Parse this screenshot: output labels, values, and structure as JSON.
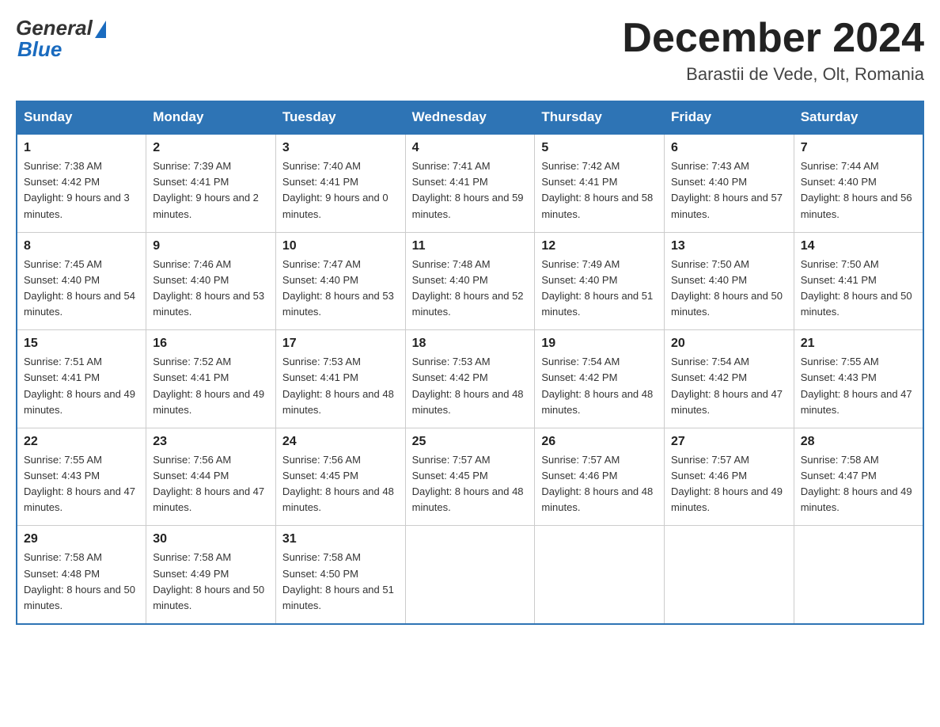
{
  "header": {
    "logo": {
      "general": "General",
      "blue": "Blue"
    },
    "title": "December 2024",
    "location": "Barastii de Vede, Olt, Romania"
  },
  "calendar": {
    "weekdays": [
      "Sunday",
      "Monday",
      "Tuesday",
      "Wednesday",
      "Thursday",
      "Friday",
      "Saturday"
    ],
    "weeks": [
      [
        {
          "day": 1,
          "sunrise": "7:38 AM",
          "sunset": "4:42 PM",
          "daylight": "9 hours and 3 minutes."
        },
        {
          "day": 2,
          "sunrise": "7:39 AM",
          "sunset": "4:41 PM",
          "daylight": "9 hours and 2 minutes."
        },
        {
          "day": 3,
          "sunrise": "7:40 AM",
          "sunset": "4:41 PM",
          "daylight": "9 hours and 0 minutes."
        },
        {
          "day": 4,
          "sunrise": "7:41 AM",
          "sunset": "4:41 PM",
          "daylight": "8 hours and 59 minutes."
        },
        {
          "day": 5,
          "sunrise": "7:42 AM",
          "sunset": "4:41 PM",
          "daylight": "8 hours and 58 minutes."
        },
        {
          "day": 6,
          "sunrise": "7:43 AM",
          "sunset": "4:40 PM",
          "daylight": "8 hours and 57 minutes."
        },
        {
          "day": 7,
          "sunrise": "7:44 AM",
          "sunset": "4:40 PM",
          "daylight": "8 hours and 56 minutes."
        }
      ],
      [
        {
          "day": 8,
          "sunrise": "7:45 AM",
          "sunset": "4:40 PM",
          "daylight": "8 hours and 54 minutes."
        },
        {
          "day": 9,
          "sunrise": "7:46 AM",
          "sunset": "4:40 PM",
          "daylight": "8 hours and 53 minutes."
        },
        {
          "day": 10,
          "sunrise": "7:47 AM",
          "sunset": "4:40 PM",
          "daylight": "8 hours and 53 minutes."
        },
        {
          "day": 11,
          "sunrise": "7:48 AM",
          "sunset": "4:40 PM",
          "daylight": "8 hours and 52 minutes."
        },
        {
          "day": 12,
          "sunrise": "7:49 AM",
          "sunset": "4:40 PM",
          "daylight": "8 hours and 51 minutes."
        },
        {
          "day": 13,
          "sunrise": "7:50 AM",
          "sunset": "4:40 PM",
          "daylight": "8 hours and 50 minutes."
        },
        {
          "day": 14,
          "sunrise": "7:50 AM",
          "sunset": "4:41 PM",
          "daylight": "8 hours and 50 minutes."
        }
      ],
      [
        {
          "day": 15,
          "sunrise": "7:51 AM",
          "sunset": "4:41 PM",
          "daylight": "8 hours and 49 minutes."
        },
        {
          "day": 16,
          "sunrise": "7:52 AM",
          "sunset": "4:41 PM",
          "daylight": "8 hours and 49 minutes."
        },
        {
          "day": 17,
          "sunrise": "7:53 AM",
          "sunset": "4:41 PM",
          "daylight": "8 hours and 48 minutes."
        },
        {
          "day": 18,
          "sunrise": "7:53 AM",
          "sunset": "4:42 PM",
          "daylight": "8 hours and 48 minutes."
        },
        {
          "day": 19,
          "sunrise": "7:54 AM",
          "sunset": "4:42 PM",
          "daylight": "8 hours and 48 minutes."
        },
        {
          "day": 20,
          "sunrise": "7:54 AM",
          "sunset": "4:42 PM",
          "daylight": "8 hours and 47 minutes."
        },
        {
          "day": 21,
          "sunrise": "7:55 AM",
          "sunset": "4:43 PM",
          "daylight": "8 hours and 47 minutes."
        }
      ],
      [
        {
          "day": 22,
          "sunrise": "7:55 AM",
          "sunset": "4:43 PM",
          "daylight": "8 hours and 47 minutes."
        },
        {
          "day": 23,
          "sunrise": "7:56 AM",
          "sunset": "4:44 PM",
          "daylight": "8 hours and 47 minutes."
        },
        {
          "day": 24,
          "sunrise": "7:56 AM",
          "sunset": "4:45 PM",
          "daylight": "8 hours and 48 minutes."
        },
        {
          "day": 25,
          "sunrise": "7:57 AM",
          "sunset": "4:45 PM",
          "daylight": "8 hours and 48 minutes."
        },
        {
          "day": 26,
          "sunrise": "7:57 AM",
          "sunset": "4:46 PM",
          "daylight": "8 hours and 48 minutes."
        },
        {
          "day": 27,
          "sunrise": "7:57 AM",
          "sunset": "4:46 PM",
          "daylight": "8 hours and 49 minutes."
        },
        {
          "day": 28,
          "sunrise": "7:58 AM",
          "sunset": "4:47 PM",
          "daylight": "8 hours and 49 minutes."
        }
      ],
      [
        {
          "day": 29,
          "sunrise": "7:58 AM",
          "sunset": "4:48 PM",
          "daylight": "8 hours and 50 minutes."
        },
        {
          "day": 30,
          "sunrise": "7:58 AM",
          "sunset": "4:49 PM",
          "daylight": "8 hours and 50 minutes."
        },
        {
          "day": 31,
          "sunrise": "7:58 AM",
          "sunset": "4:50 PM",
          "daylight": "8 hours and 51 minutes."
        },
        null,
        null,
        null,
        null
      ]
    ]
  }
}
